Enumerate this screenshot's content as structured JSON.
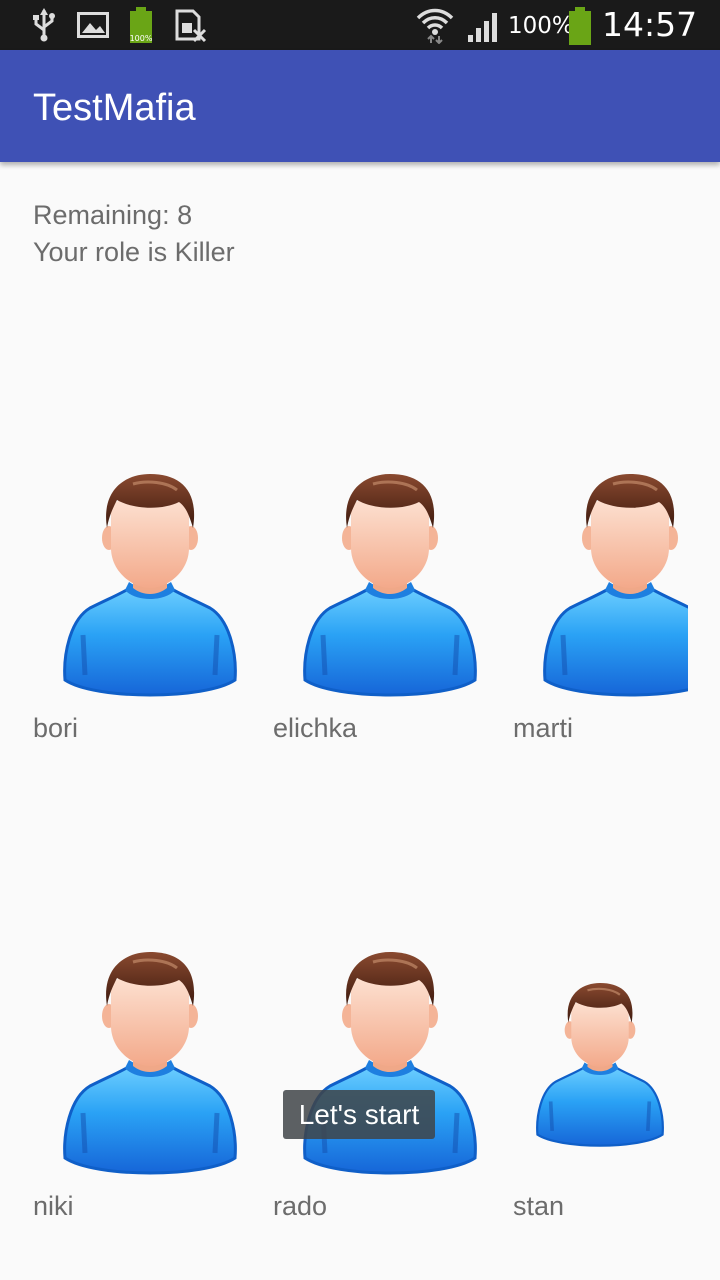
{
  "status_bar": {
    "battery_percent": "100%",
    "time": "14:57",
    "icons": [
      "usb-icon",
      "image-icon",
      "battery-small-icon",
      "sim-off-icon",
      "wifi-icon",
      "signal-icon",
      "battery-icon"
    ]
  },
  "app_bar": {
    "title": "TestMafia"
  },
  "info": {
    "remaining": "Remaining: 8",
    "role": "Your role is Killer"
  },
  "players": [
    {
      "name": "bori"
    },
    {
      "name": "elichka"
    },
    {
      "name": "marti"
    },
    {
      "name": "niki"
    },
    {
      "name": "rado"
    },
    {
      "name": "stan"
    }
  ],
  "toast": {
    "text": "Let's start"
  },
  "colors": {
    "status_bar": "#1a1a1a",
    "app_bar": "#3f51b5",
    "background": "#fafafa",
    "text": "#6c6c6c",
    "avatar_shirt": "#1e90ff",
    "avatar_hair": "#5a2a1a",
    "avatar_skin": "#f8c4a8"
  }
}
